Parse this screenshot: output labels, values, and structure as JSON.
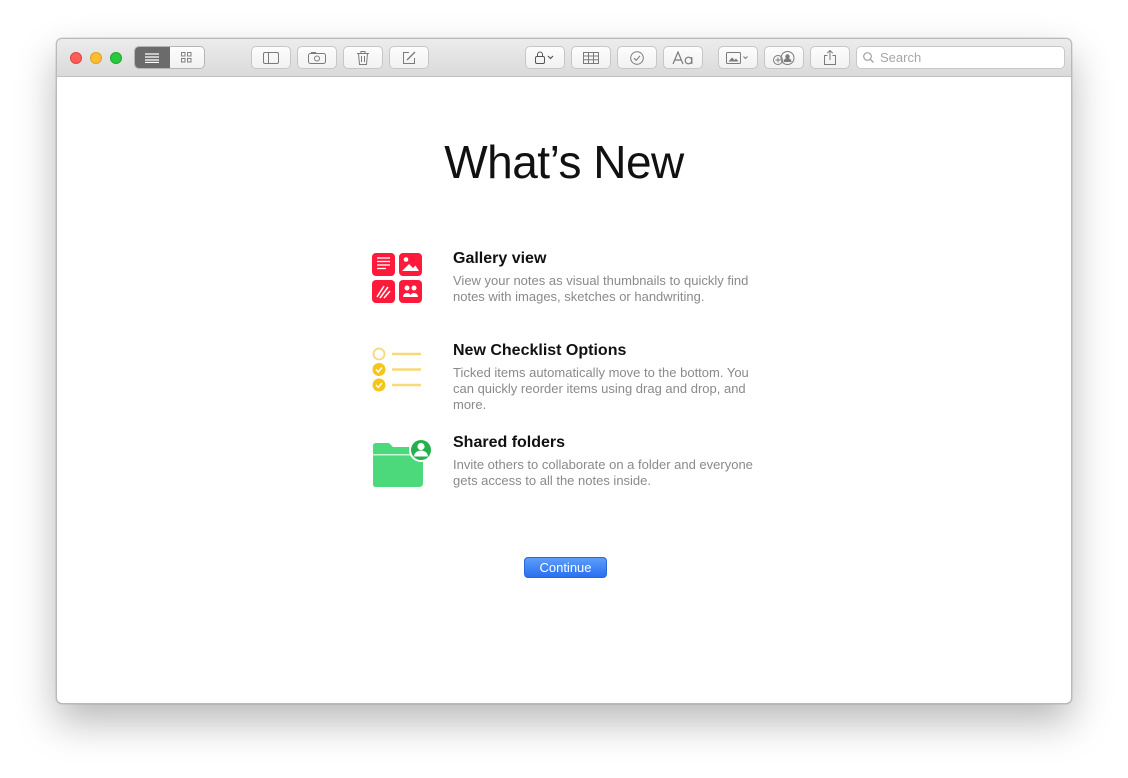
{
  "toolbar": {
    "view_list_icon": "list-view-icon",
    "view_gallery_icon": "gallery-view-icon",
    "search_placeholder": "Search"
  },
  "main": {
    "title": "What’s New",
    "features": [
      {
        "title": "Gallery view",
        "description": "View your notes as visual thumbnails to quickly find notes with images, sketches or handwriting.",
        "icon": "gallery-view-feature-icon",
        "color": "#ff1a3c"
      },
      {
        "title": "New Checklist Options",
        "description": "Ticked items automatically move to the bottom. You can quickly reorder items using drag and drop, and more.",
        "icon": "checklist-feature-icon",
        "color": "#f5c518"
      },
      {
        "title": "Shared folders",
        "description": "Invite others to collaborate on a folder and everyone gets access to all the notes inside.",
        "icon": "shared-folder-feature-icon",
        "color": "#4cd97b"
      }
    ],
    "continue_label": "Continue"
  },
  "colors": {
    "accent": "#2a6ff0",
    "close": "#fe5f57",
    "minimize": "#febc2e",
    "zoom": "#28c840"
  }
}
